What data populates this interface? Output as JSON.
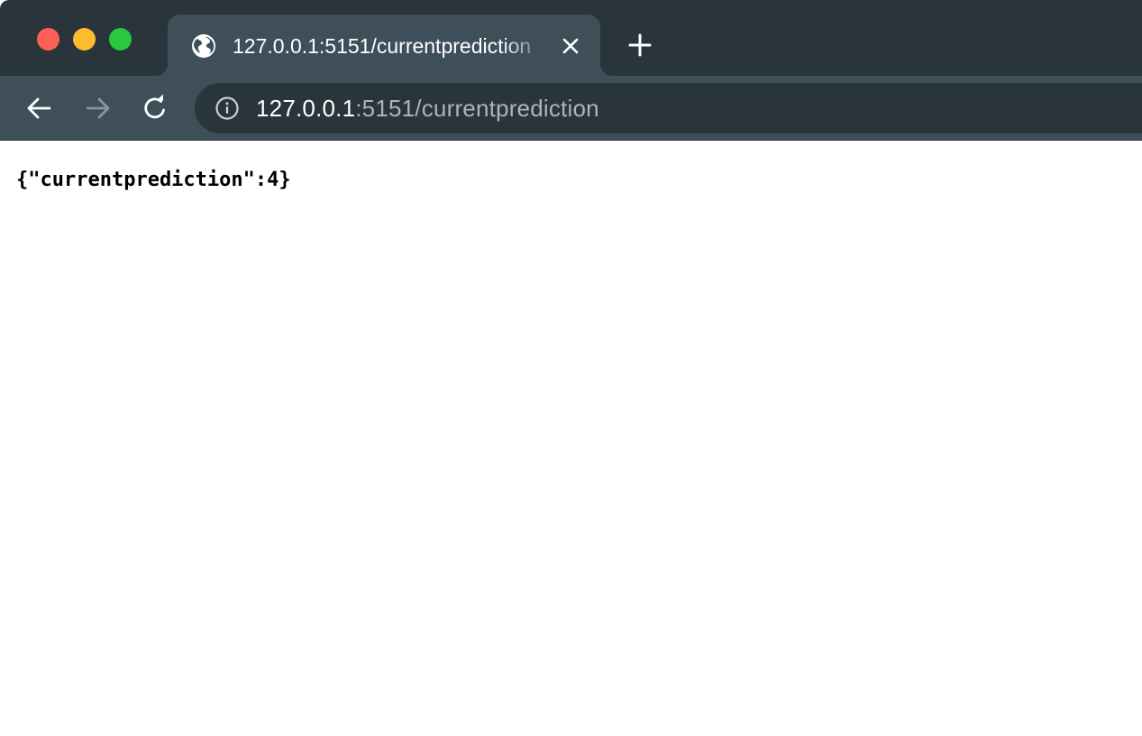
{
  "browser": {
    "tab": {
      "title": "127.0.0.1:5151/currentprediction",
      "favicon": "globe-icon"
    },
    "window_controls": {
      "close_color": "#fe5f57",
      "minimize_color": "#febc2e",
      "maximize_color": "#28c840"
    },
    "toolbar": {
      "back_icon": "arrow-left-icon",
      "forward_icon": "arrow-right-icon",
      "reload_icon": "reload-icon",
      "site_info_icon": "info-icon"
    },
    "address_bar": {
      "host": "127.0.0.1",
      "path": ":5151/currentprediction"
    }
  },
  "page": {
    "body_text": "{\"currentprediction\":4}"
  },
  "colors": {
    "tabstrip": "#29343b",
    "toolbar": "#3e4f59",
    "omnibox": "#2a353b",
    "page_background": "#ffffff"
  }
}
